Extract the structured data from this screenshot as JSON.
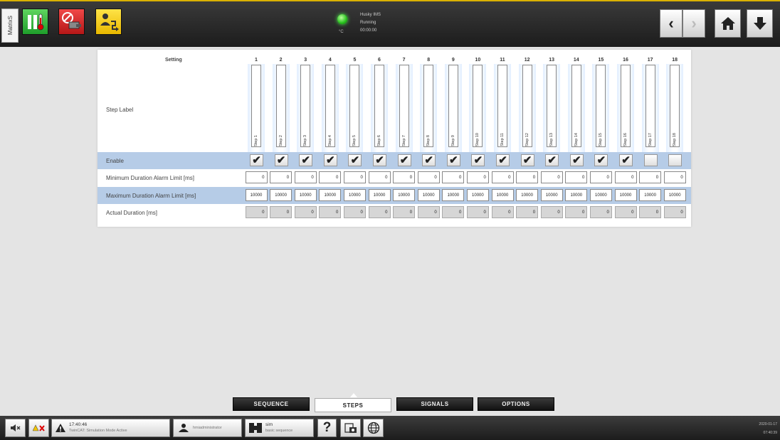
{
  "header": {
    "side_tab": "MatrixS",
    "status_lines": [
      "Husky IMS",
      "Running",
      "00:00:00"
    ],
    "status_unit": "°C",
    "colors": {
      "accent": "#d9b100",
      "green": "#1f9e2b",
      "red": "#b51717",
      "yellow": "#e8b800"
    }
  },
  "table": {
    "setting_header": "Setting",
    "rows": {
      "step_label": "Step Label",
      "enable": "Enable",
      "min": "Minimum Duration Alarm Limit [ms]",
      "max": "Maximum Duration Alarm Limit [ms]",
      "actual": "Actual Duration [ms]"
    },
    "steps": [
      {
        "num": "1",
        "label": "Step 1",
        "enabled": true,
        "min": "0",
        "max": "10000",
        "actual": "0"
      },
      {
        "num": "2",
        "label": "Step 2",
        "enabled": true,
        "min": "0",
        "max": "10000",
        "actual": "0"
      },
      {
        "num": "3",
        "label": "Step 3",
        "enabled": true,
        "min": "0",
        "max": "10000",
        "actual": "0"
      },
      {
        "num": "4",
        "label": "Step 4",
        "enabled": true,
        "min": "0",
        "max": "10000",
        "actual": "0"
      },
      {
        "num": "5",
        "label": "Step 5",
        "enabled": true,
        "min": "0",
        "max": "10000",
        "actual": "0"
      },
      {
        "num": "6",
        "label": "Step 6",
        "enabled": true,
        "min": "0",
        "max": "10000",
        "actual": "0"
      },
      {
        "num": "7",
        "label": "Step 7",
        "enabled": true,
        "min": "0",
        "max": "10000",
        "actual": "0"
      },
      {
        "num": "8",
        "label": "Step 8",
        "enabled": true,
        "min": "0",
        "max": "10000",
        "actual": "0"
      },
      {
        "num": "9",
        "label": "Step 9",
        "enabled": true,
        "min": "0",
        "max": "10000",
        "actual": "0"
      },
      {
        "num": "10",
        "label": "Step 10",
        "enabled": true,
        "min": "0",
        "max": "10000",
        "actual": "0"
      },
      {
        "num": "11",
        "label": "Step 11",
        "enabled": true,
        "min": "0",
        "max": "10000",
        "actual": "0"
      },
      {
        "num": "12",
        "label": "Step 12",
        "enabled": true,
        "min": "0",
        "max": "10000",
        "actual": "0"
      },
      {
        "num": "13",
        "label": "Step 13",
        "enabled": true,
        "min": "0",
        "max": "10000",
        "actual": "0"
      },
      {
        "num": "14",
        "label": "Step 14",
        "enabled": true,
        "min": "0",
        "max": "10000",
        "actual": "0"
      },
      {
        "num": "15",
        "label": "Step 15",
        "enabled": true,
        "min": "0",
        "max": "10000",
        "actual": "0"
      },
      {
        "num": "16",
        "label": "Step 16",
        "enabled": true,
        "min": "0",
        "max": "10000",
        "actual": "0"
      },
      {
        "num": "17",
        "label": "Step 17",
        "enabled": false,
        "min": "0",
        "max": "10000",
        "actual": "0"
      },
      {
        "num": "18",
        "label": "Step 18",
        "enabled": false,
        "min": "0",
        "max": "10000",
        "actual": "0"
      }
    ]
  },
  "tabs": [
    "SEQUENCE",
    "STEPS",
    "SIGNALS",
    "OPTIONS"
  ],
  "active_tab": "STEPS",
  "footer": {
    "alarm_time": "17:40:46",
    "alarm_text": "TwinCAT: Simulation Mode Active",
    "user": "hmiadministrator",
    "mode_main": "sim",
    "mode_sub": "basic sequence",
    "help": "?",
    "date": "2020-01-17",
    "time": "07:40:39"
  }
}
